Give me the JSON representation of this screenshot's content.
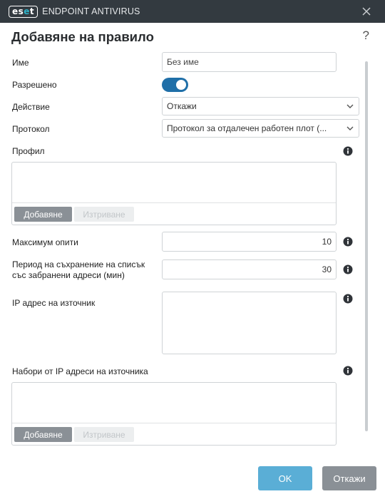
{
  "titlebar": {
    "logo_text": "eset",
    "logo_left": "es",
    "logo_mid": "e",
    "logo_right": "t",
    "app_name": "ENDPOINT ANTIVIRUS",
    "close_icon": "close-icon"
  },
  "header": {
    "title": "Добавяне на правило",
    "help_label": "?"
  },
  "form": {
    "name_label": "Име",
    "name_value": "Без име",
    "enabled_label": "Разрешено",
    "enabled_value": true,
    "action_label": "Действие",
    "action_value": "Откажи",
    "protocol_label": "Протокол",
    "protocol_value": "Протокол за отдалечен работен плот (...",
    "profile_label": "Профил",
    "profile_add": "Добавяне",
    "profile_delete": "Изтриване",
    "max_attempts_label": "Максимум опити",
    "max_attempts_value": "10",
    "blacklist_period_label_line1": "Период на съхранение на списък",
    "blacklist_period_label_line2": "със забранени адреси (мин)",
    "blacklist_period_value": "30",
    "source_ip_label": "IP адрес на източник",
    "source_ip_sets_label": "Набори от IP адреси на източника",
    "sets_add": "Добавяне",
    "sets_delete": "Изтриване"
  },
  "footer": {
    "ok_label": "OK",
    "cancel_label": "Откажи"
  },
  "colors": {
    "titlebar_bg": "#333a40",
    "toggle_on": "#1f6fa8",
    "ok_button": "#5aaed6",
    "cancel_button": "#8a9096",
    "info_icon": "#2f3338"
  }
}
